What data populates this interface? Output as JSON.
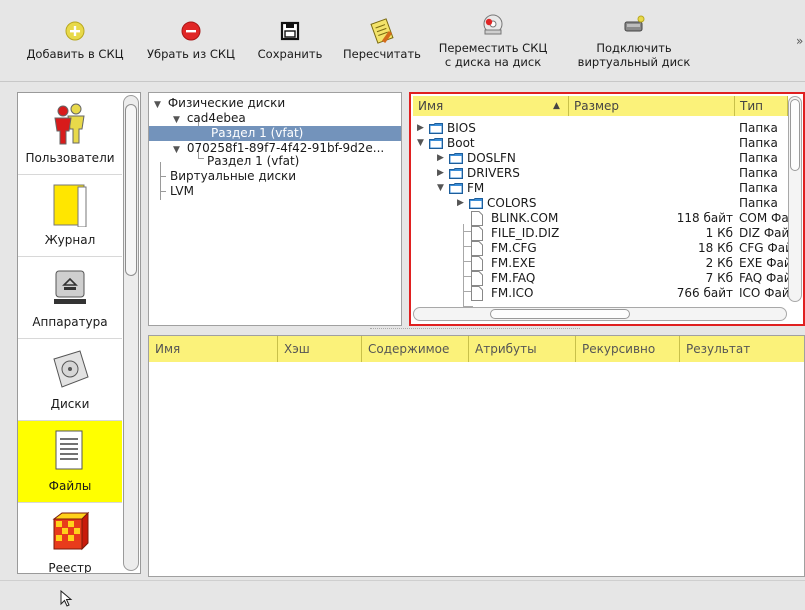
{
  "toolbar": {
    "add_label": "Добавить в СКЦ",
    "remove_label": "Убрать из СКЦ",
    "save_label": "Сохранить",
    "recalc_label": "Пересчитать",
    "move_label_1": "Переместить СКЦ",
    "move_label_2": "с диска на диск",
    "connect_label_1": "Подключить",
    "connect_label_2": "виртуальный диск",
    "overflow": "»"
  },
  "categories": {
    "users": "Пользователи",
    "journal": "Журнал",
    "hardware": "Аппаратура",
    "disks": "Диски",
    "files": "Файлы",
    "registry": "Реестр"
  },
  "disk_tree": {
    "physical": "Физические диски",
    "disk1": "cad4ebea",
    "disk1_part": "Раздел 1 (vfat)",
    "disk2": "070258f1-89f7-4f42-91bf-9d2e...",
    "disk2_part": "Раздел 1 (vfat)",
    "virtual": "Виртуальные диски",
    "lvm": "LVM"
  },
  "file_browser": {
    "col_name": "Имя",
    "col_size": "Размер",
    "col_type": "Тип",
    "sort_indicator": "▲",
    "rows": [
      {
        "name": "BIOS",
        "size": "",
        "type": "Папка"
      },
      {
        "name": "Boot",
        "size": "",
        "type": "Папка"
      },
      {
        "name": "DOSLFN",
        "size": "",
        "type": "Папка"
      },
      {
        "name": "DRIVERS",
        "size": "",
        "type": "Папка"
      },
      {
        "name": "FM",
        "size": "",
        "type": "Папка"
      },
      {
        "name": "COLORS",
        "size": "",
        "type": "Папка"
      },
      {
        "name": "BLINK.COM",
        "size": "118 байт",
        "type": "COM Фай"
      },
      {
        "name": "FILE_ID.DIZ",
        "size": "1 Кб",
        "type": "DIZ Файл"
      },
      {
        "name": "FM.CFG",
        "size": "18 Кб",
        "type": "CFG Фай"
      },
      {
        "name": "FM.EXE",
        "size": "2 Кб",
        "type": "EXE Фай"
      },
      {
        "name": "FM.FAQ",
        "size": "7 Кб",
        "type": "FAQ Фай"
      },
      {
        "name": "FM.ICO",
        "size": "766 байт",
        "type": "ICO Фай"
      }
    ]
  },
  "results": {
    "col_name": "Имя",
    "col_hash": "Хэш",
    "col_content": "Содержимое",
    "col_attrs": "Атрибуты",
    "col_recursive": "Рекурсивно",
    "col_result": "Результат"
  },
  "colors": {
    "header_yellow": "#fbf27a",
    "selection_blue": "#7393bb",
    "active_category": "#ffff00",
    "highlight_border": "#e02020",
    "folder_blue": "#3d8fd8"
  },
  "icons": {
    "add": "plus-circle-icon",
    "remove": "minus-circle-icon",
    "save": "floppy-icon",
    "recalc": "notepad-pencil-icon",
    "move": "disk-move-icon",
    "connect": "virtual-disk-icon"
  }
}
